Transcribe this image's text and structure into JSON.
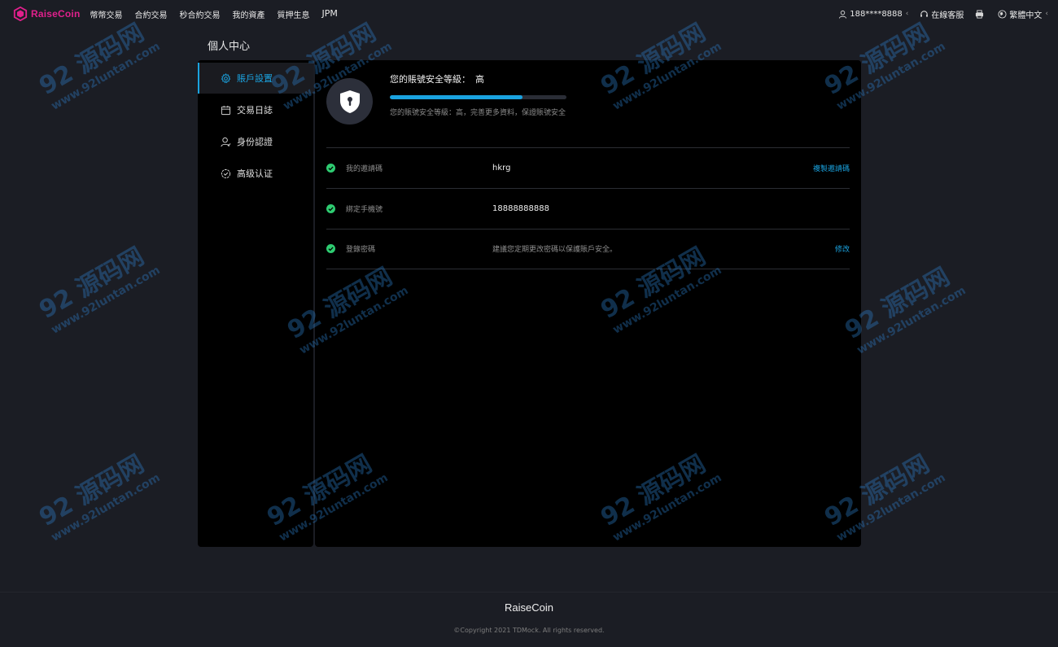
{
  "brand": {
    "name": "RaiseCoin",
    "color": "#e0208c"
  },
  "nav": {
    "items": [
      "幣幣交易",
      "合約交易",
      "秒合約交易",
      "我的資產",
      "質押生息",
      "JPM"
    ]
  },
  "top_right": {
    "user": "188****8888",
    "support": "在線客服",
    "language": "繁體中文"
  },
  "page_title": "個人中心",
  "sidebar": {
    "items": [
      {
        "label": "賬戶設置",
        "icon": "gear-icon"
      },
      {
        "label": "交易日誌",
        "icon": "calendar-icon"
      },
      {
        "label": "身份認證",
        "icon": "user-icon"
      },
      {
        "label": "高级认证",
        "icon": "badge-check-icon"
      }
    ],
    "active_index": 0
  },
  "security": {
    "title": "您的賬號安全等級：",
    "level": "高",
    "progress": 0.75,
    "description": "您的賬號安全等級：高，完善更多資料，保證賬號安全"
  },
  "rows": [
    {
      "label": "我的邀請碼",
      "value": "hkrg",
      "action": "複製邀請碼"
    },
    {
      "label": "綁定手機號",
      "value": "18888888888",
      "action": ""
    },
    {
      "label": "登錄密碼",
      "hint": "建議您定期更改密碼以保護賬戶安全。",
      "action": "修改"
    }
  ],
  "footer": {
    "brand": "RaiseCoin",
    "copyright": "©Copyright 2021 TDMock. All rights reserved."
  },
  "watermark": {
    "top": "92 源码网",
    "bottom": "www.92luntan.com"
  },
  "colors": {
    "accent": "#1aa3e0",
    "check": "#2ecc71",
    "background": "#1b1d24",
    "panel": "#000000"
  }
}
